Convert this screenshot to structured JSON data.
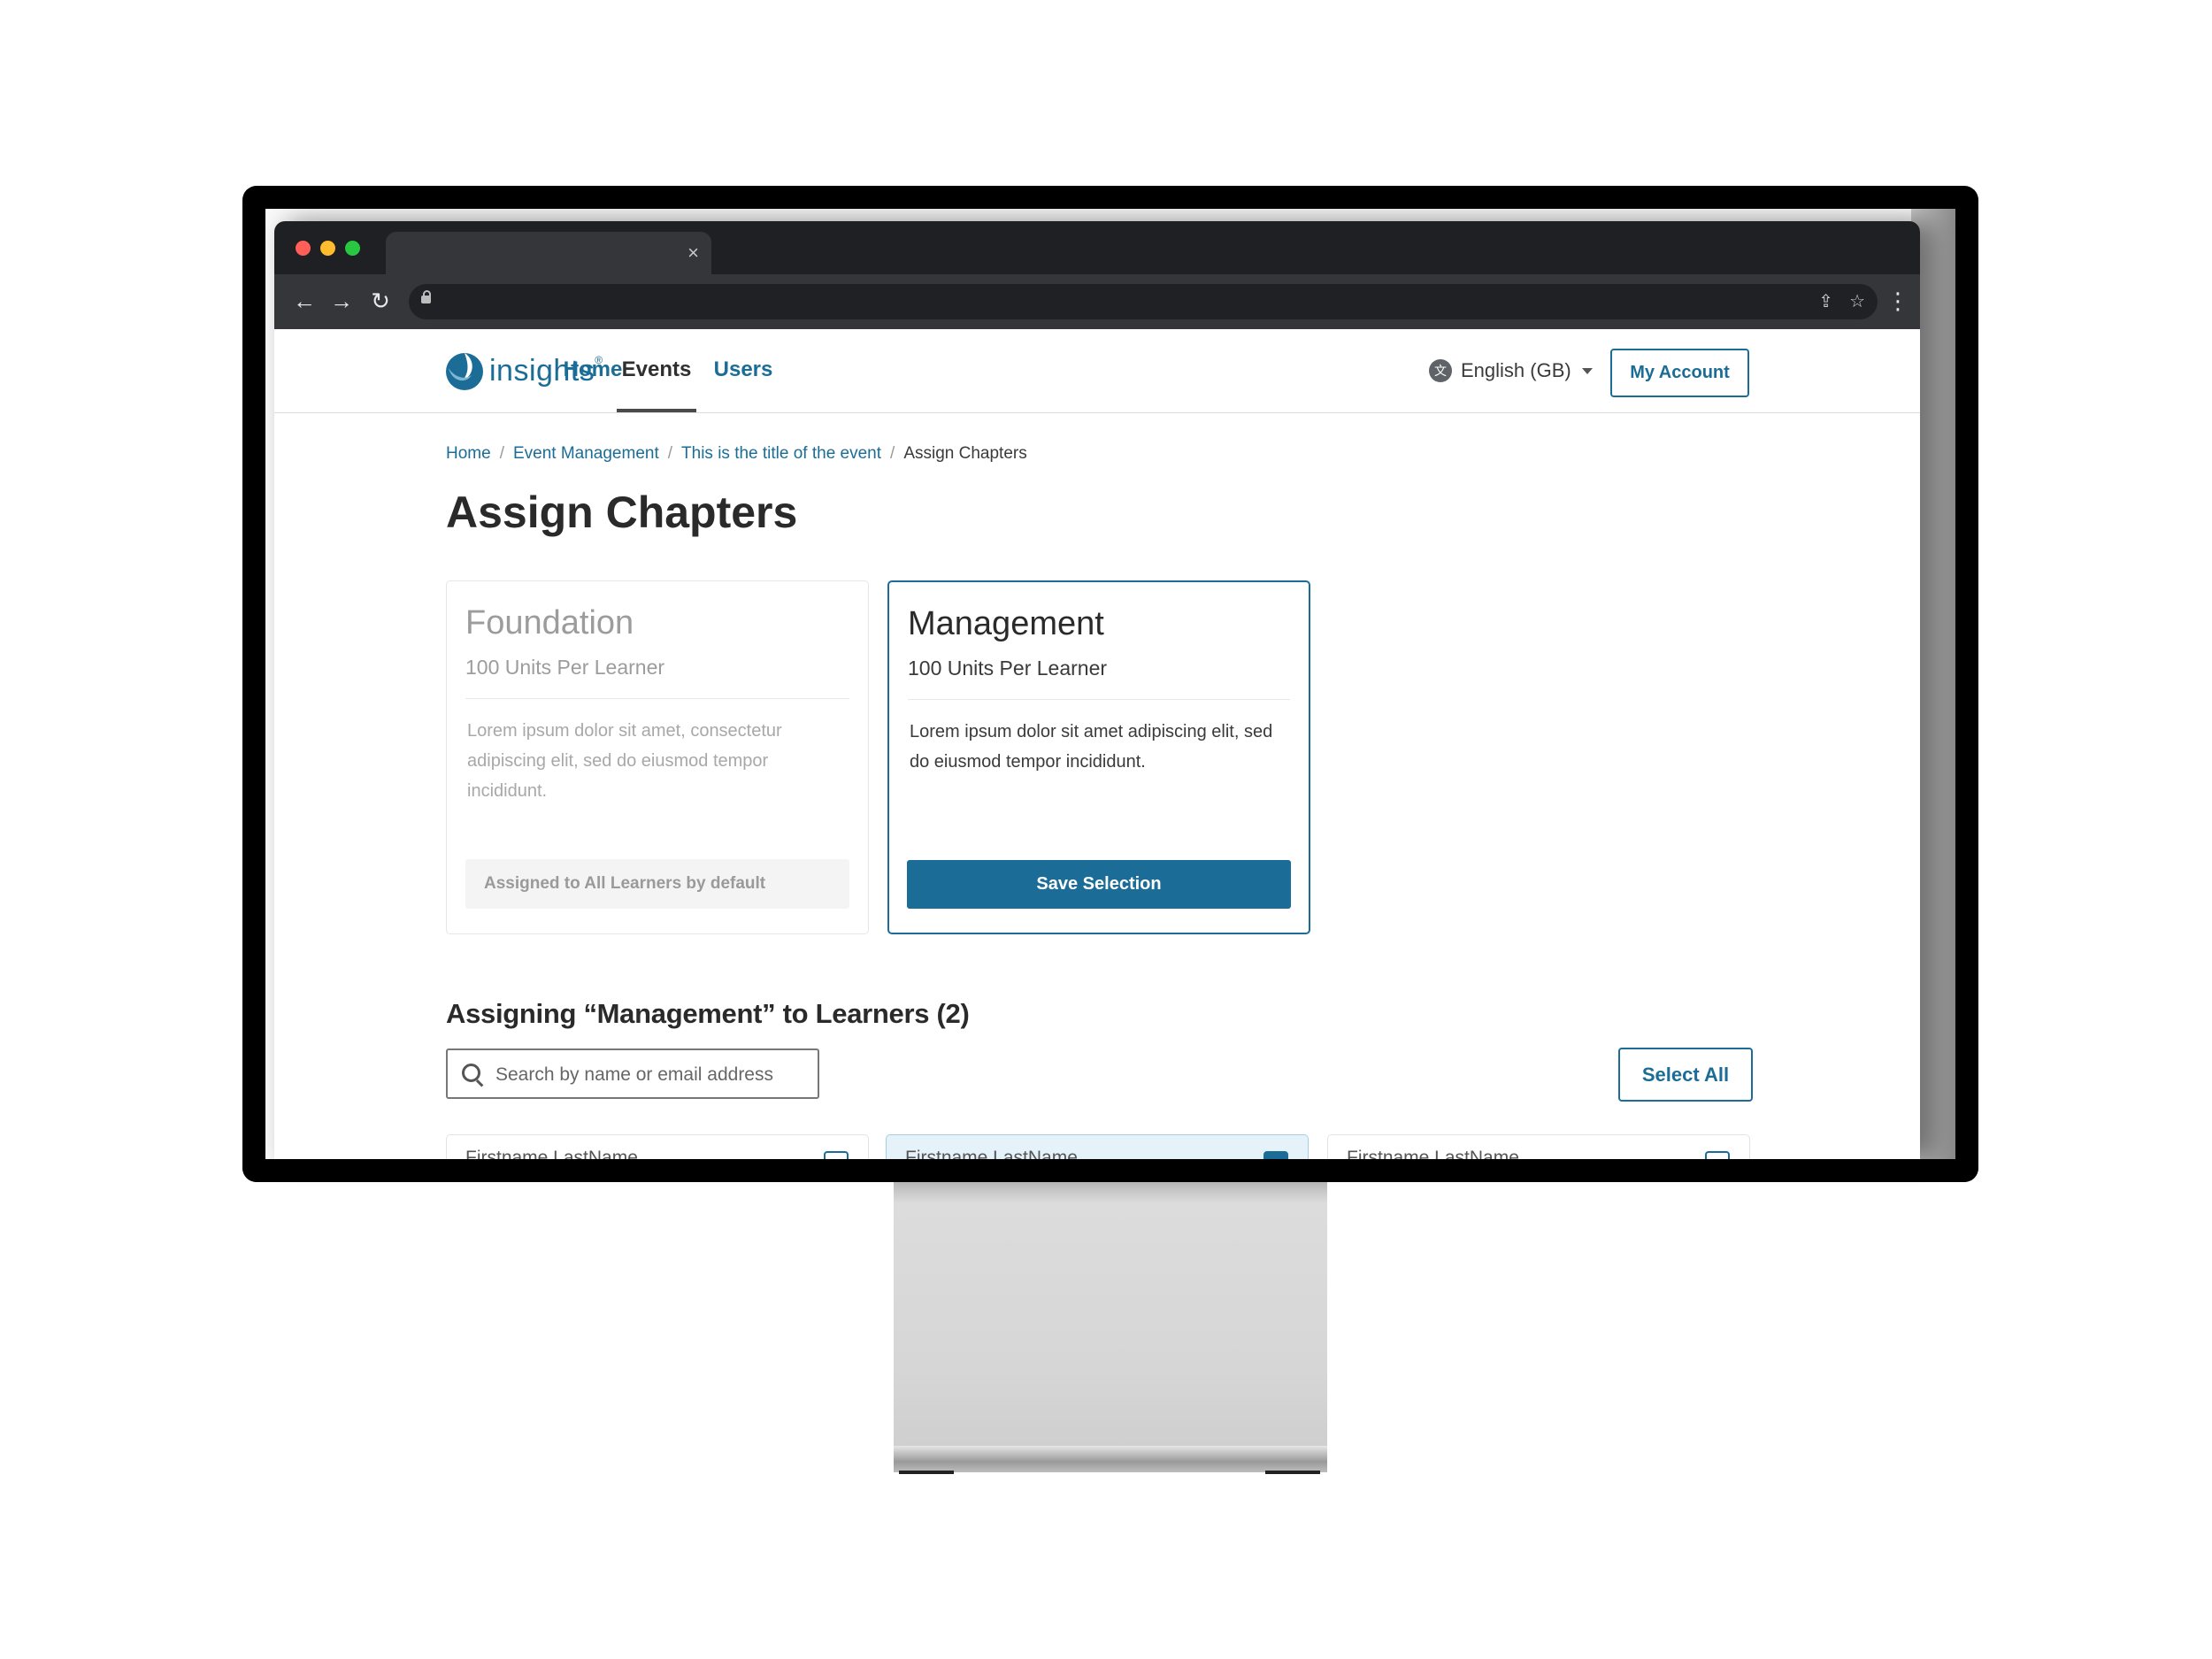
{
  "browser": {
    "tab_close": "×",
    "back": "←",
    "forward": "→",
    "reload": "↻",
    "share": "⇪",
    "bookmark": "☆",
    "menu": "⋮"
  },
  "app": {
    "logo_text": "insights",
    "logo_mark": "®",
    "nav": [
      {
        "label": "Home"
      },
      {
        "label": "Events"
      },
      {
        "label": "Users"
      }
    ],
    "language": "English (GB)",
    "language_icon": "文",
    "account_label": "My Account"
  },
  "breadcrumb": {
    "items": [
      "Home",
      "Event Management",
      "This is the title of the event"
    ],
    "current": "Assign Chapters",
    "separator": "/"
  },
  "page": {
    "title": "Assign Chapters"
  },
  "chapters": [
    {
      "title": "Foundation",
      "units": "100 Units Per Learner",
      "description": "Lorem ipsum dolor sit amet, consectetur adipiscing elit, sed do eiusmod tempor incididunt.",
      "note": "Assigned to All Learners by default"
    },
    {
      "title": "Management",
      "units": "100 Units Per Learner",
      "description": "Lorem ipsum dolor sit amet adipiscing elit, sed do eiusmod tempor incididunt.",
      "action_label": "Save Selection"
    }
  ],
  "learners_section": {
    "title": "Assigning “Management” to Learners (2)",
    "search_placeholder": "Search by name or email address",
    "select_all_label": "Select All",
    "learners": [
      {
        "name": "Firstname LastName",
        "selected": false
      },
      {
        "name": "Firstname LastName",
        "selected": true
      },
      {
        "name": "Firstname LastName",
        "selected": false
      }
    ]
  },
  "colors": {
    "brand": "#1b6d97",
    "text_dark": "#2a2a2a",
    "muted": "#9c9c9c"
  }
}
